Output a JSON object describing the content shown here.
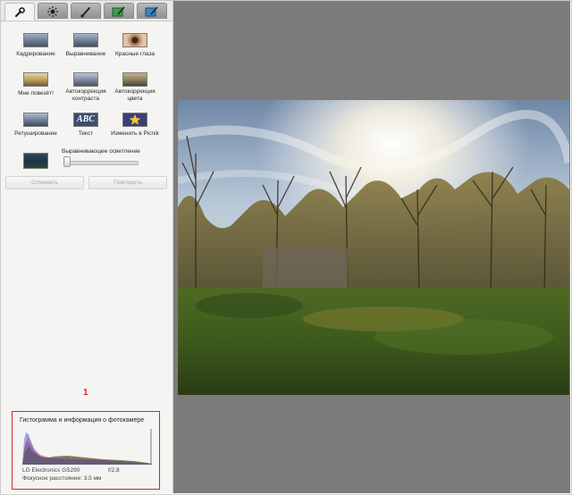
{
  "tabs": [
    {
      "icon": "wrench-icon",
      "active": true
    },
    {
      "icon": "brightness-icon",
      "active": false
    },
    {
      "icon": "brush-icon",
      "active": false
    },
    {
      "icon": "frame-icon",
      "active": false
    },
    {
      "icon": "edit-icon",
      "active": false
    }
  ],
  "tools": {
    "crop": "Кадрирование",
    "straighten": "Выравнивание",
    "red_eye": "Красные глаза",
    "feeling_lucky": "Мне повезёт!",
    "auto_contrast_1": "Автокоррекция",
    "auto_contrast_2": "контраста",
    "auto_color_1": "Автокоррекция",
    "auto_color_2": "цвета",
    "retouch": "Ретуширование",
    "text": "Текст",
    "picnik": "Изменить в Picnik",
    "text_thumb": "ABC",
    "fill_light": "Выравнивающее осветление"
  },
  "buttons": {
    "undo": "Отменить",
    "redo": "Повторить"
  },
  "annotation": {
    "marker": "1",
    "color": "#e02020"
  },
  "histogram": {
    "title": "Гистограмма и информация о фотокамере",
    "camera": "LG Electronics GS290",
    "aperture": "f/2.8",
    "focal": "Фокусное расстояние: 3.5 мм"
  },
  "colors": {
    "panel": "#f4f4f2",
    "canvas": "#7d7b79"
  }
}
